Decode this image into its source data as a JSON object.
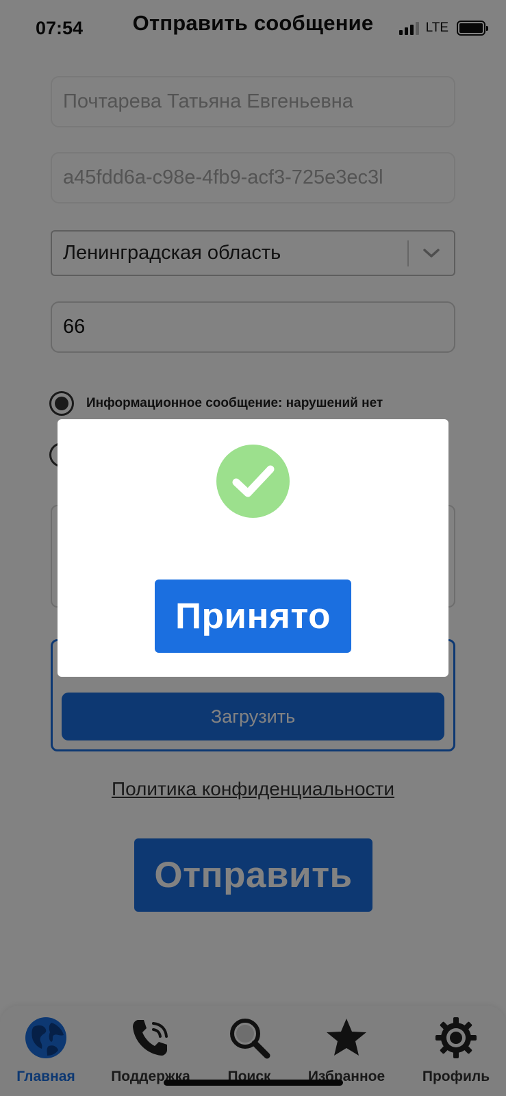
{
  "status_bar": {
    "time": "07:54",
    "network": "LTE",
    "signal_bars_filled": 3
  },
  "header": {
    "title": "Отправить сообщение"
  },
  "form": {
    "full_name": "Почтарева Татьяна Евгеньевна",
    "uuid": "a45fdd6a-c98e-4fb9-acf3-725e3ec3l",
    "region_selected": "Ленинградская область",
    "number_value": "66",
    "radio_options": [
      {
        "label": "Информационное сообщение: нарушений нет",
        "selected": true
      },
      {
        "label": "",
        "selected": false
      }
    ],
    "upload_label": "Загрузить",
    "privacy_link": "Политика конфиденциальности",
    "send_label": "Отправить"
  },
  "modal": {
    "icon": "check-circle-icon",
    "confirm_label": "Принято"
  },
  "tab_bar": {
    "items": [
      {
        "label": "Главная",
        "icon": "globe-icon",
        "active": true
      },
      {
        "label": "Поддержка",
        "icon": "phone-icon",
        "active": false
      },
      {
        "label": "Поиск",
        "icon": "search-icon",
        "active": false
      },
      {
        "label": "Избранное",
        "icon": "star-icon",
        "active": false
      },
      {
        "label": "Профиль",
        "icon": "gear-icon",
        "active": false
      }
    ]
  },
  "colors": {
    "accent": "#1b6fe0",
    "success": "#9ce08d",
    "overlay": "rgba(0,0,0,0.49)"
  }
}
